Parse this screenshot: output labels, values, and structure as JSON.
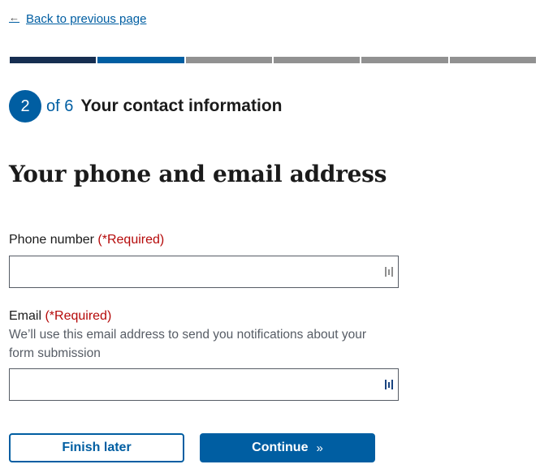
{
  "back_link": {
    "label": "Back to previous page",
    "icon": "arrow-left-icon"
  },
  "progress": {
    "current": 2,
    "total": 6,
    "segment_states": [
      "complete",
      "current",
      "incomplete",
      "incomplete",
      "incomplete",
      "incomplete"
    ],
    "colors": {
      "complete": "#162e51",
      "current": "#005ea2",
      "incomplete": "#919191"
    }
  },
  "step": {
    "number": "2",
    "of_text": "of 6",
    "title": "Your contact information"
  },
  "page_title": "Your phone and email address",
  "fields": {
    "phone": {
      "label": "Phone number",
      "required": "(*Required)",
      "value": "",
      "placeholder": ""
    },
    "email": {
      "label": "Email",
      "required": "(*Required)",
      "hint": "We’ll use this email address to send you notifications about your form submission",
      "value": "",
      "placeholder": ""
    }
  },
  "buttons": {
    "finish_later": "Finish later",
    "continue": "Continue",
    "continue_icon": "»"
  },
  "colors": {
    "primary": "#005ea2",
    "required": "#b50909",
    "text": "#1b1b1b",
    "hint": "#565c65"
  }
}
